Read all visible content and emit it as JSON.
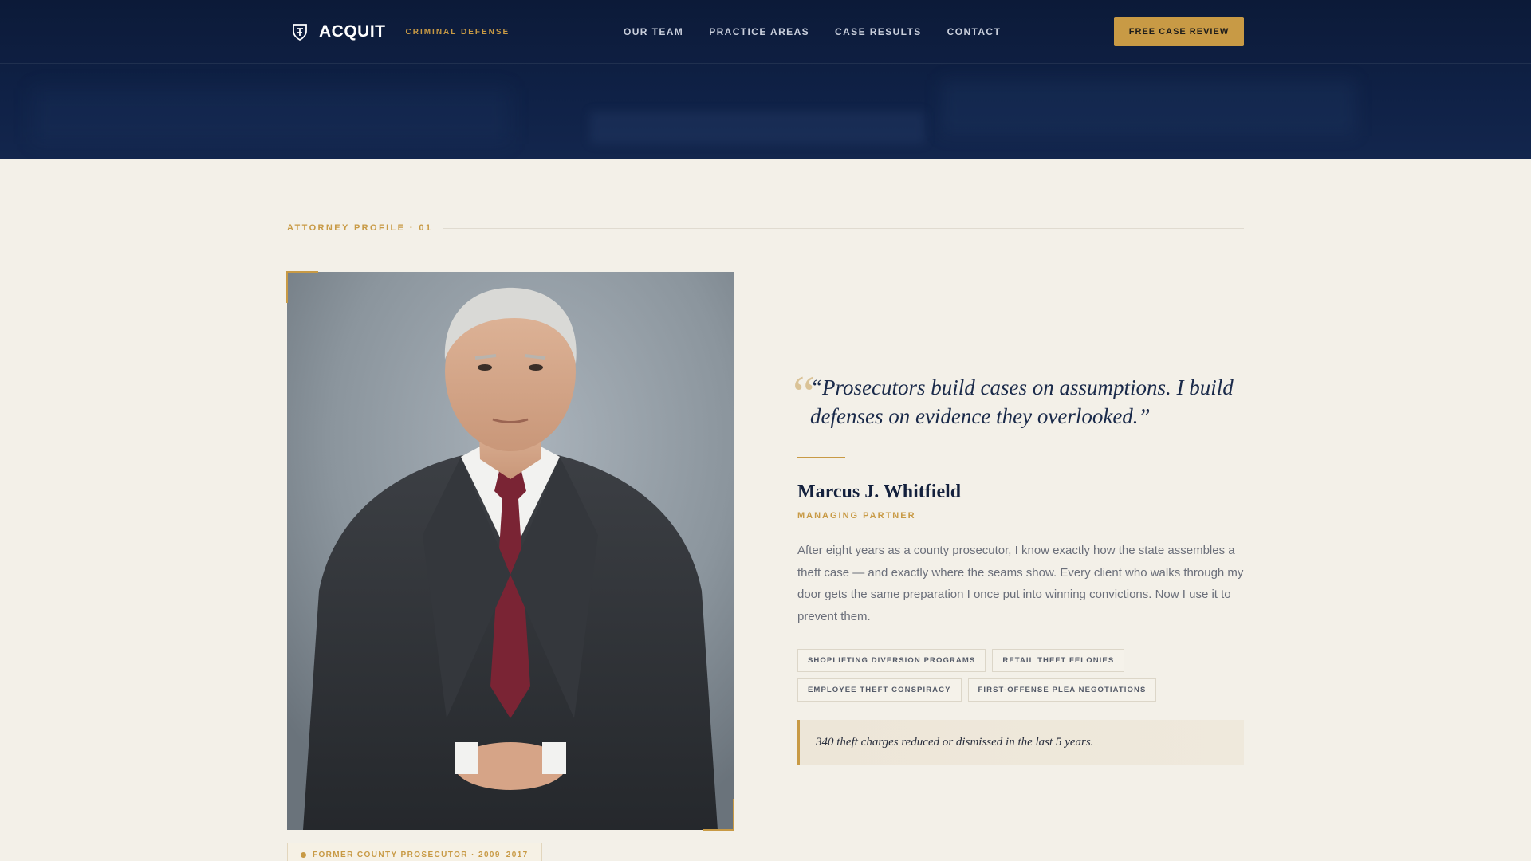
{
  "nav": {
    "brand": "ACQUIT",
    "tagline": "CRIMINAL DEFENSE",
    "links": [
      "OUR TEAM",
      "PRACTICE AREAS",
      "CASE RESULTS",
      "CONTACT"
    ],
    "cta": "FREE CASE REVIEW"
  },
  "section": {
    "label": "ATTORNEY PROFILE · 01"
  },
  "profile": {
    "badge": "FORMER COUNTY PROSECUTOR · 2009–2017",
    "quote": "“Prosecutors build cases on assumptions. I build defenses on evidence they overlooked.”",
    "name": "Marcus J. Whitfield",
    "role": "MANAGING PARTNER",
    "bio": "After eight years as a county prosecutor, I know exactly how the state assembles a theft case — and exactly where the seams show. Every client who walks through my door gets the same preparation I once put into winning convictions. Now I use it to prevent them.",
    "tags": [
      "SHOPLIFTING DIVERSION PROGRAMS",
      "RETAIL THEFT FELONIES",
      "EMPLOYEE THEFT CONSPIRACY",
      "FIRST-OFFENSE PLEA NEGOTIATIONS"
    ],
    "stat": "340 theft charges reduced or dismissed in the last 5 years."
  },
  "colors": {
    "navy": "#0f2146",
    "gold": "#c89a45",
    "cream": "#f3f0e8"
  },
  "icons": {
    "logo": "shield-crest-icon",
    "quote": "quote-mark-icon"
  }
}
